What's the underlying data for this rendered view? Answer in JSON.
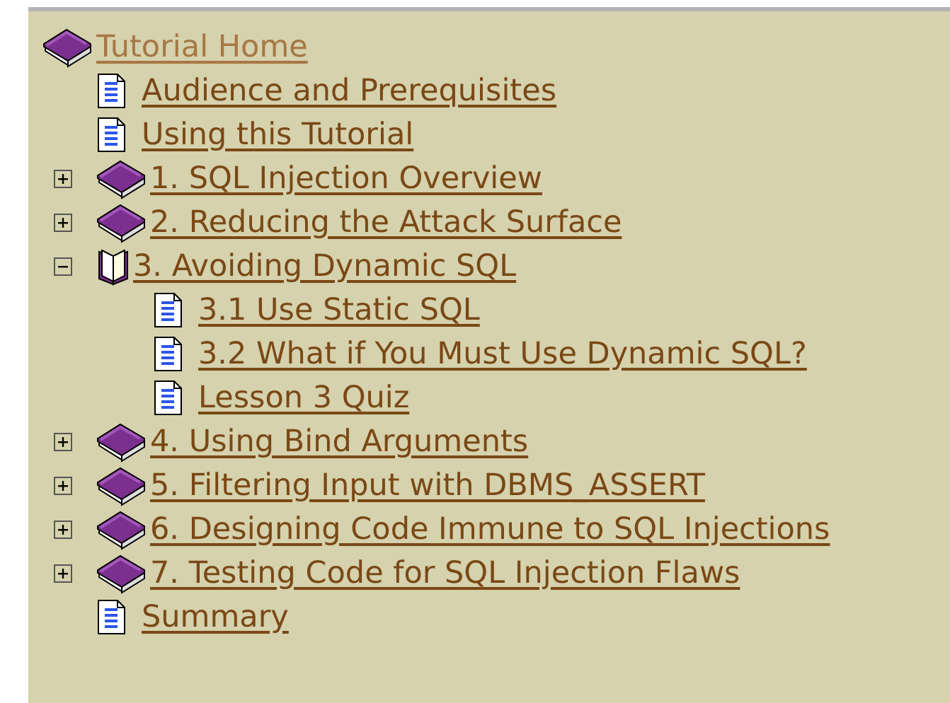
{
  "tree": [
    {
      "label": "Tutorial Home",
      "kind": "book",
      "selected": true,
      "children": [
        {
          "label": "Audience and Prerequisites",
          "kind": "page",
          "selected": false
        },
        {
          "label": "Using this Tutorial",
          "kind": "page",
          "selected": false
        },
        {
          "label": "1. SQL Injection Overview",
          "kind": "book",
          "selected": false,
          "expanded": false
        },
        {
          "label": "2. Reducing the Attack Surface",
          "kind": "book",
          "selected": false,
          "expanded": false
        },
        {
          "label": "3. Avoiding Dynamic SQL",
          "kind": "book",
          "selected": false,
          "expanded": true,
          "children": [
            {
              "label": "3.1 Use Static SQL",
              "kind": "page",
              "selected": false
            },
            {
              "label": "3.2 What if You Must Use Dynamic SQL?",
              "kind": "page",
              "selected": false
            },
            {
              "label": "Lesson 3 Quiz",
              "kind": "page",
              "selected": false
            }
          ]
        },
        {
          "label": "4. Using Bind Arguments",
          "kind": "book",
          "selected": false,
          "expanded": false
        },
        {
          "label": "5. Filtering Input with DBMS_ASSERT",
          "kind": "book",
          "selected": false,
          "expanded": false
        },
        {
          "label": "6. Designing Code Immune to SQL Injections",
          "kind": "book",
          "selected": false,
          "expanded": false
        },
        {
          "label": "7. Testing Code for SQL Injection Flaws",
          "kind": "book",
          "selected": false,
          "expanded": false
        },
        {
          "label": "Summary",
          "kind": "page",
          "selected": false
        }
      ]
    }
  ]
}
